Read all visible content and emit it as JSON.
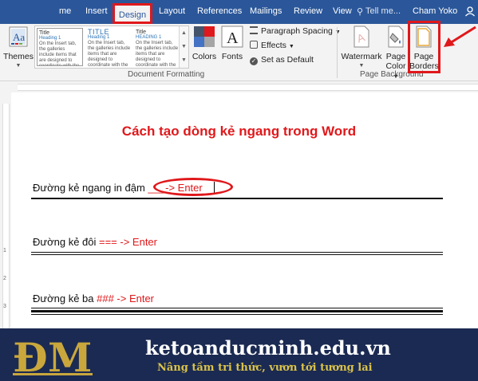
{
  "tabs": {
    "home": "me",
    "insert": "Insert",
    "design": "Design",
    "layout": "Layout",
    "references": "References",
    "mailings": "Mailings",
    "review": "Review",
    "view": "View",
    "tell_me": "Tell me...",
    "user": "Cham Yoko"
  },
  "ribbon": {
    "themes_label": "Themes",
    "thumbs": [
      {
        "title": "Title",
        "heading": "Heading 1",
        "body": "On the Insert tab, the galleries include items that are designed to coordinate with the overall look of your document. You can use these"
      },
      {
        "title": "TITLE",
        "heading": "Heading 1",
        "body": "On the Insert tab, the galleries include items that are designed to coordinate with the overall look of your document."
      },
      {
        "title": "Title",
        "heading": "HEADING 1",
        "body": "On the Insert tab, the galleries include items that are designed to coordinate with the overall look of your document."
      }
    ],
    "colors_label": "Colors",
    "fonts_label": "Fonts",
    "paragraph_spacing_label": "Paragraph Spacing",
    "effects_label": "Effects",
    "set_default_label": "Set as Default",
    "document_formatting_label": "Document Formatting",
    "watermark_label": "Watermark",
    "page_color_label_1": "Page",
    "page_color_label_2": "Color",
    "page_borders_label_1": "Page",
    "page_borders_label_2": "Borders",
    "page_background_label": "Page Background"
  },
  "ruler": {
    "left_numbers": [
      "1",
      "2",
      "3"
    ]
  },
  "document": {
    "title": "Cách tạo dòng kẻ ngang trong Word",
    "line1_text": "Đường kẻ ngang in đậm ",
    "line1_code": "___-> Enter",
    "line2_text": "Đường kẻ đôi ",
    "line2_code": "=== -> Enter",
    "line3_text": "Đường kẻ ba ",
    "line3_code": "### -> Enter"
  },
  "banner": {
    "site": "ketoanducminh.edu.vn",
    "slogan": "Nâng tầm tri thức, vươn tới tương lai"
  },
  "colors": {
    "accent_red": "#e0181b",
    "word_blue": "#2b579a",
    "banner_bg": "#1b2a52",
    "logo_gold": "#c9a73c"
  }
}
